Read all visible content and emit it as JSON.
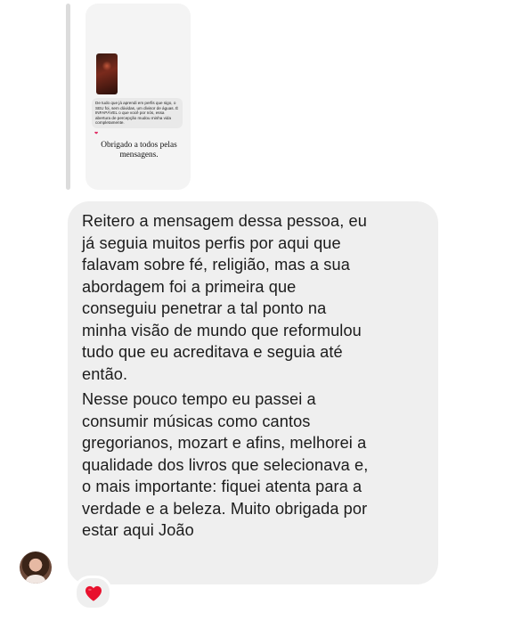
{
  "story_reply": {
    "quote": "De tudo que já aprendi em perfis que sigo, o SEU foi, sem dúvidas, um divisor de águas. É INFAPÁVEL o que você por nós, essa abertura de percepção mudou minha vida completamente.",
    "caption_line1": "Obrigado a todos pelas",
    "caption_line2": "mensagens."
  },
  "message": {
    "paragraph1": [
      "Reitero a mensagem dessa pessoa, eu",
      "já seguia muitos perfis por aqui que",
      "falavam sobre fé, religião, mas a sua",
      "abordagem foi a primeira que",
      "conseguiu penetrar a tal ponto na",
      "minha visão de mundo que reformulou",
      "tudo que eu acreditava e seguia até",
      "então."
    ],
    "paragraph2": [
      "Nesse pouco tempo eu passei a",
      "consumir músicas como cantos",
      "gregorianos, mozart e afins, melhorei a",
      "qualidade dos livros que selecionava e,",
      "o mais importante: fiquei atenta para a",
      "verdade e a beleza. Muito obrigada por",
      "estar aqui João"
    ]
  },
  "reaction": {
    "icon": "heart-icon",
    "color": "#e8112d"
  },
  "colors": {
    "bubble": "#efefef",
    "text": "#1c1c1c",
    "reply_bar": "#dcdcdc"
  }
}
